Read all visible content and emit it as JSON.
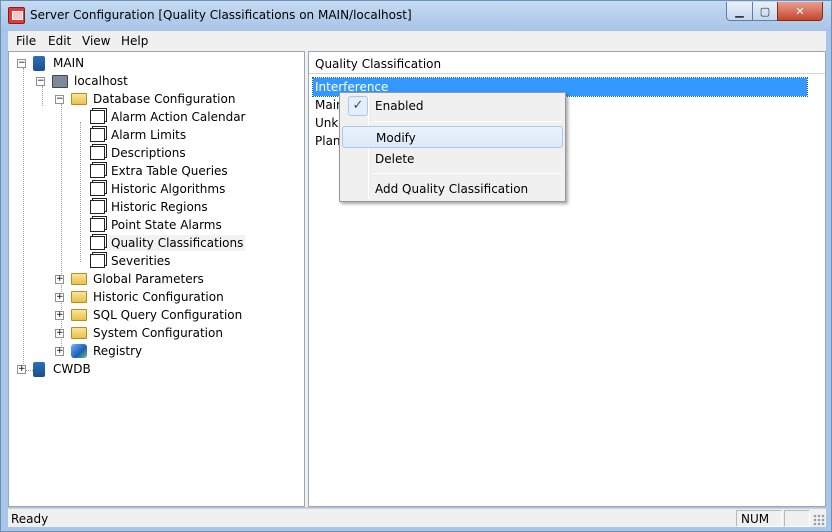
{
  "window": {
    "title": "Server Configuration [Quality Classifications on MAIN/localhost]"
  },
  "menubar": {
    "items": [
      "File",
      "Edit",
      "View",
      "Help"
    ]
  },
  "tree": {
    "nodes": [
      {
        "label": "MAIN",
        "icon": "network-server-icon",
        "expander": "−"
      },
      {
        "label": "localhost",
        "icon": "computer-icon",
        "expander": "−"
      },
      {
        "label": "Database Configuration",
        "icon": "folder-icon",
        "expander": "−"
      },
      {
        "label": "Alarm Action Calendar",
        "icon": "properties-icon"
      },
      {
        "label": "Alarm Limits",
        "icon": "properties-icon"
      },
      {
        "label": "Descriptions",
        "icon": "properties-icon"
      },
      {
        "label": "Extra Table Queries",
        "icon": "properties-icon"
      },
      {
        "label": "Historic Algorithms",
        "icon": "properties-icon"
      },
      {
        "label": "Historic Regions",
        "icon": "properties-icon"
      },
      {
        "label": "Point State Alarms",
        "icon": "properties-icon"
      },
      {
        "label": "Quality Classifications",
        "icon": "properties-icon"
      },
      {
        "label": "Severities",
        "icon": "properties-icon"
      },
      {
        "label": "Global Parameters",
        "icon": "folder-icon",
        "expander": "+"
      },
      {
        "label": "Historic Configuration",
        "icon": "folder-icon",
        "expander": "+"
      },
      {
        "label": "SQL Query Configuration",
        "icon": "folder-icon",
        "expander": "+"
      },
      {
        "label": "System Configuration",
        "icon": "folder-icon",
        "expander": "+"
      },
      {
        "label": "Registry",
        "icon": "registry-icon",
        "expander": "+"
      },
      {
        "label": "CWDB",
        "icon": "network-server-icon",
        "expander": "+"
      }
    ]
  },
  "list": {
    "header": "Quality Classification",
    "rows": [
      "Interference",
      "Main",
      "Unkn",
      "Plant"
    ]
  },
  "context_menu": {
    "check_mark": "✓",
    "items": {
      "enabled": "Enabled",
      "modify": "Modify",
      "delete": "Delete",
      "add": "Add Quality Classification"
    }
  },
  "statusbar": {
    "text": "Ready",
    "num": "NUM"
  },
  "colors": {
    "selection": "#3399ff",
    "title_gradient_top": "#c6dbf3",
    "close_button": "#c7452e"
  }
}
